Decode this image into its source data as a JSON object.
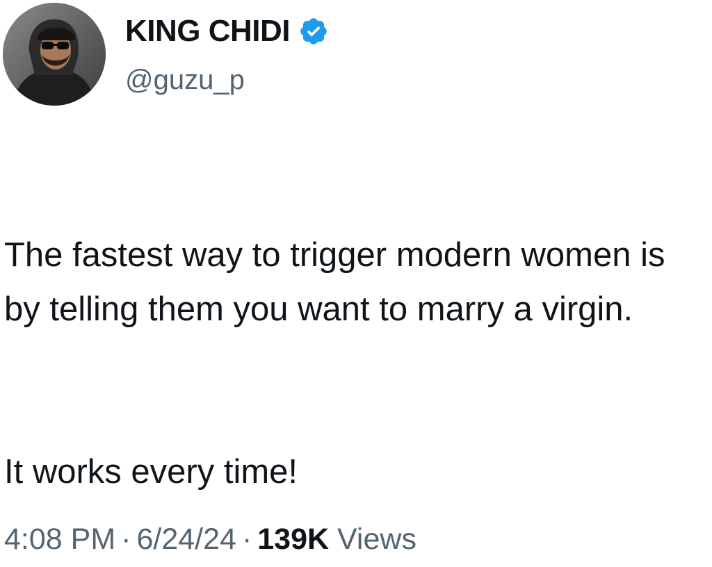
{
  "author": {
    "display_name": "KING CHIDI",
    "handle": "@guzu_p",
    "verified": true,
    "verified_icon": "verified-badge-icon",
    "verified_color": "#1d9bf0"
  },
  "tweet": {
    "paragraphs": [
      "The fastest way to trigger modern women is by telling them you want to marry a virgin.",
      "It works every time!"
    ]
  },
  "meta": {
    "time": "4:08 PM",
    "separator": "·",
    "date": "6/24/24",
    "views_count": "139K",
    "views_label": "Views"
  },
  "colors": {
    "text_primary": "#0f1419",
    "text_secondary": "#536471",
    "background": "#ffffff"
  }
}
